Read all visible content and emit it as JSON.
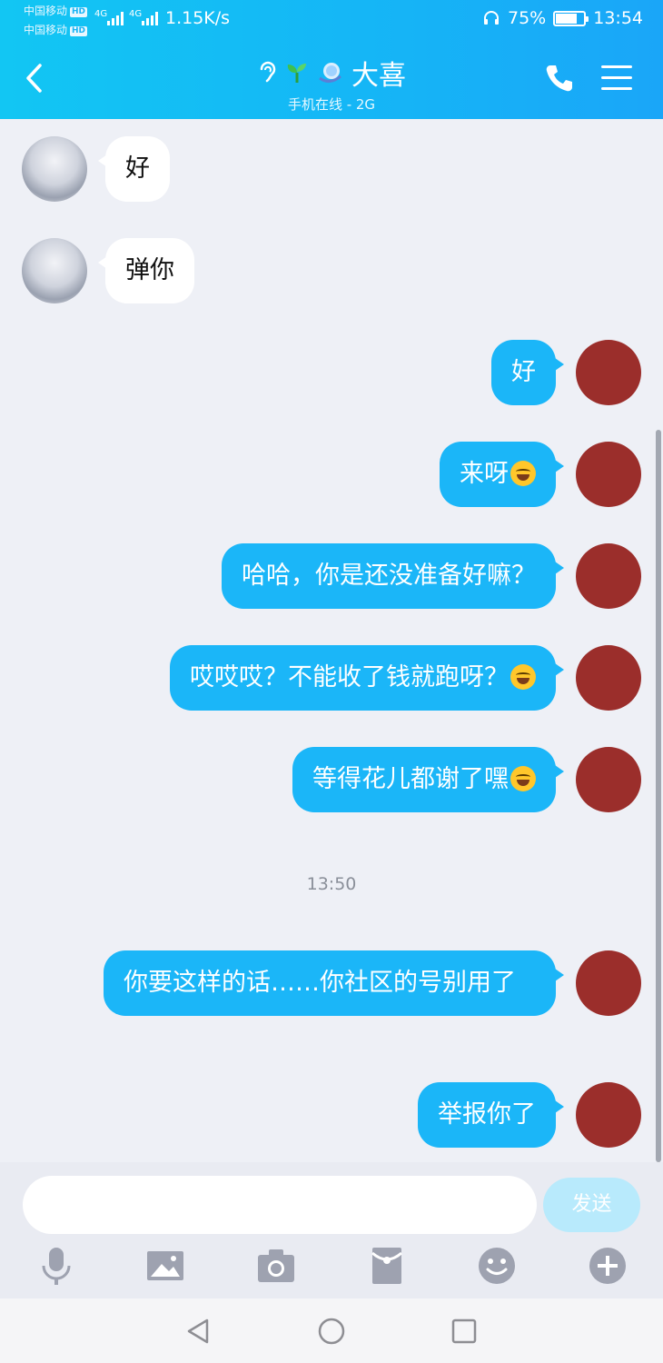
{
  "status_bar": {
    "carrier_1": "中国移动",
    "carrier_2": "中国移动",
    "hd_badge": "HD",
    "network_type": "4G",
    "net_speed": "1.15K/s",
    "battery": "75%",
    "battery_level": 0.75,
    "time": "13:54"
  },
  "header": {
    "contact_name": "大喜",
    "subtitle": "手机在线 - 2G",
    "status_icons": [
      "ear-icon",
      "sprout-icon",
      "moon-icon"
    ]
  },
  "messages": [
    {
      "side": "left",
      "text": "好"
    },
    {
      "side": "left",
      "text": "弹你"
    },
    {
      "side": "right",
      "text": "好"
    },
    {
      "side": "right",
      "text": "来呀",
      "emoji": "laugh-cry-emoji"
    },
    {
      "side": "right",
      "text": "哈哈，你是还没准备好嘛？"
    },
    {
      "side": "right",
      "text": "哎哎哎？不能收了钱就跑呀？",
      "emoji": "laugh-cry-emoji"
    },
    {
      "side": "right",
      "text": "等得花儿都谢了嘿",
      "emoji": "laugh-cry-emoji"
    },
    {
      "side": "time",
      "text": "13:50"
    },
    {
      "side": "right",
      "text": "你要这样的话……你社区的号别用了"
    },
    {
      "side": "right",
      "text": "举报你了"
    }
  ],
  "input": {
    "placeholder": "",
    "send_label": "发送"
  },
  "toolbar_icons": [
    "mic-icon",
    "image-icon",
    "camera-icon",
    "red-packet-icon",
    "emoji-icon",
    "plus-icon"
  ],
  "colors": {
    "header": "#15b6f6",
    "bubble_self": "#1bb6f8",
    "bubble_other": "#ffffff",
    "background": "#eef0f6",
    "send_disabled": "#b8eafc"
  }
}
